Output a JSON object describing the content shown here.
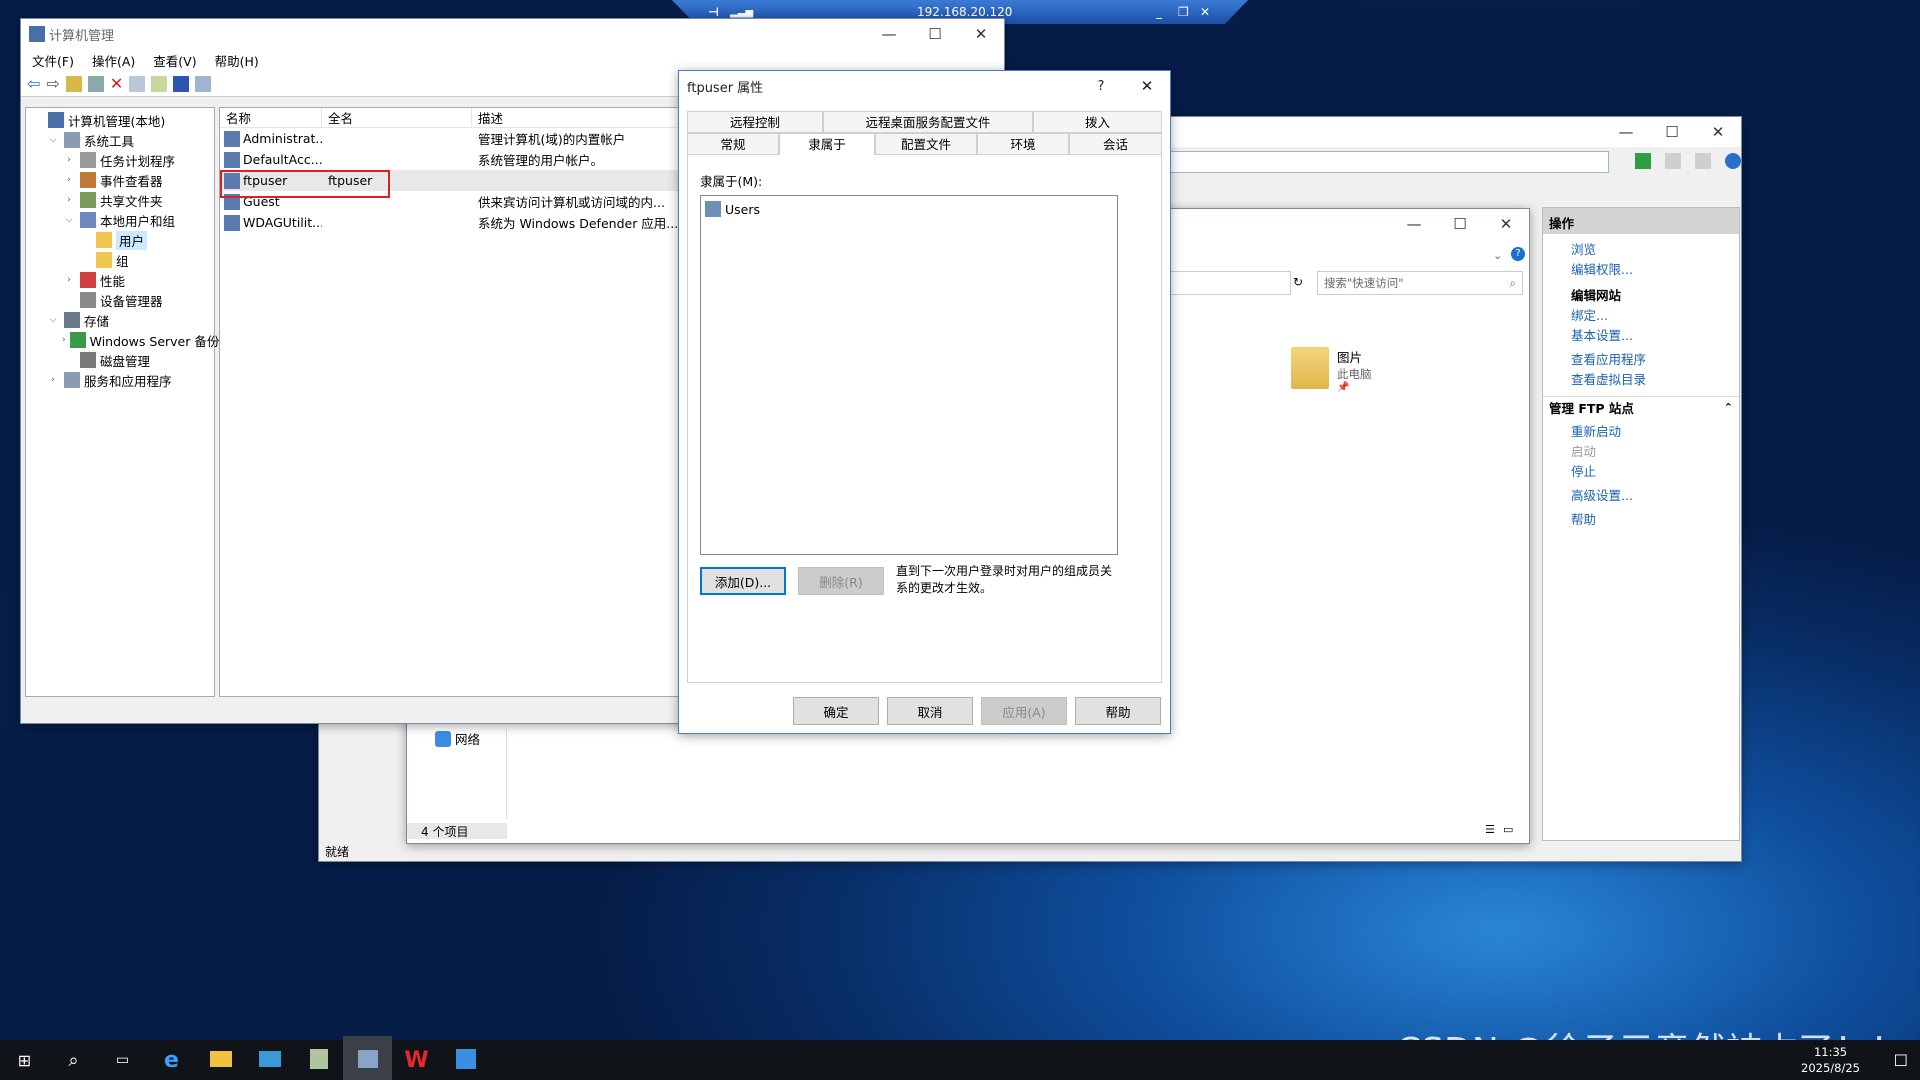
{
  "remote_bar": {
    "address": "192.168.20.120"
  },
  "comp_mgmt": {
    "title": "计算机管理",
    "menu": [
      "文件(F)",
      "操作(A)",
      "查看(V)",
      "帮助(H)"
    ],
    "tree": [
      {
        "label": "计算机管理(本地)",
        "level": 0,
        "exp": ""
      },
      {
        "label": "系统工具",
        "level": 1,
        "exp": "v"
      },
      {
        "label": "任务计划程序",
        "level": 2,
        "exp": ">"
      },
      {
        "label": "事件查看器",
        "level": 2,
        "exp": ">"
      },
      {
        "label": "共享文件夹",
        "level": 2,
        "exp": ">"
      },
      {
        "label": "本地用户和组",
        "level": 2,
        "exp": "v"
      },
      {
        "label": "用户",
        "level": 3,
        "exp": ""
      },
      {
        "label": "组",
        "level": 3,
        "exp": ""
      },
      {
        "label": "性能",
        "level": 2,
        "exp": ">"
      },
      {
        "label": "设备管理器",
        "level": 2,
        "exp": ""
      },
      {
        "label": "存储",
        "level": 1,
        "exp": "v"
      },
      {
        "label": "Windows Server 备份",
        "level": 2,
        "exp": ">"
      },
      {
        "label": "磁盘管理",
        "level": 2,
        "exp": ""
      },
      {
        "label": "服务和应用程序",
        "level": 1,
        "exp": ">"
      }
    ],
    "columns": [
      "名称",
      "全名",
      "描述"
    ],
    "users": [
      {
        "name": "Administrat...",
        "full": "",
        "desc": "管理计算机(域)的内置帐户"
      },
      {
        "name": "DefaultAcc...",
        "full": "",
        "desc": "系统管理的用户帐户。"
      },
      {
        "name": "ftpuser",
        "full": "ftpuser",
        "desc": ""
      },
      {
        "name": "Guest",
        "full": "",
        "desc": "供来宾访问计算机或访问域的内..."
      },
      {
        "name": "WDAGUtilit...",
        "full": "",
        "desc": "系统为 Windows Defender 应用..."
      }
    ]
  },
  "dialog": {
    "title": "ftpuser 属性",
    "help_glyph": "?",
    "tabs_row1": [
      "远程控制",
      "远程桌面服务配置文件",
      "拨入"
    ],
    "tabs_row2": [
      "常规",
      "隶属于",
      "配置文件",
      "环境",
      "会话"
    ],
    "member_of_label": "隶属于(M):",
    "groups": [
      "Users"
    ],
    "add_btn": "添加(D)...",
    "remove_btn": "删除(R)",
    "note": "直到下一次用户登录时对用户的组成员关系的更改才生效。",
    "ok": "确定",
    "cancel": "取消",
    "apply": "应用(A)",
    "help": "帮助"
  },
  "iis": {
    "actions_header": "操作",
    "browse": "浏览",
    "edit_perms": "编辑权限...",
    "edit_site": "编辑网站",
    "bindings": "绑定...",
    "basic_settings": "基本设置...",
    "view_apps": "查看应用程序",
    "view_vdirs": "查看虚拟目录",
    "manage_ftp": "管理 FTP 站点",
    "restart": "重新启动",
    "start": "启动",
    "stop": "停止",
    "advanced": "高级设置...",
    "help": "帮助",
    "status": "就绪"
  },
  "explorer": {
    "search_placeholder": "搜索\"快速访问\"",
    "pictures": "图片",
    "this_pc": "此电脑",
    "network": "网络",
    "item_count": "4 个项目"
  },
  "watermark": "CSDN @徐子元竟然被占了！！",
  "clock": {
    "time": "11:35",
    "date": "2025/8/25"
  },
  "colors": {
    "accent": "#0078d7",
    "highlight_box": "#d9202a",
    "link": "#1a5fb4"
  }
}
